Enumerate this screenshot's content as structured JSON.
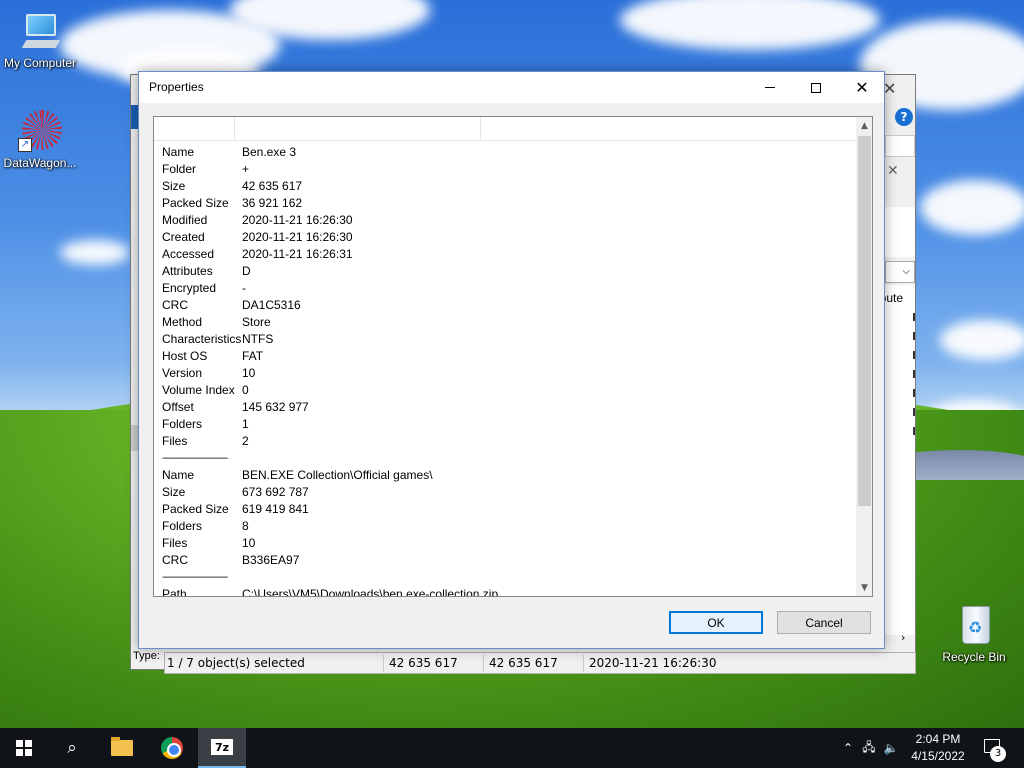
{
  "desktop": {
    "icons": [
      {
        "label": "My Computer"
      },
      {
        "label": "DataWagon..."
      },
      {
        "label": "Recycle Bin"
      }
    ]
  },
  "background_window": {
    "type_label": "Type: ",
    "column_fragment": "ribute",
    "status": {
      "selected": "1 / 7 object(s) selected",
      "size": "42 635 617",
      "packed": "42 635 617",
      "modified": "2020-11-21 16:26:30"
    }
  },
  "dialog": {
    "title": "Properties",
    "properties": [
      {
        "k": "Name",
        "v": "Ben.exe 3"
      },
      {
        "k": "Folder",
        "v": "+"
      },
      {
        "k": "Size",
        "v": "42 635 617"
      },
      {
        "k": "Packed Size",
        "v": "36 921 162"
      },
      {
        "k": "Modified",
        "v": "2020-11-21 16:26:30"
      },
      {
        "k": "Created",
        "v": "2020-11-21 16:26:30"
      },
      {
        "k": "Accessed",
        "v": "2020-11-21 16:26:31"
      },
      {
        "k": "Attributes",
        "v": "D"
      },
      {
        "k": "Encrypted",
        "v": "-"
      },
      {
        "k": "CRC",
        "v": "DA1C5316"
      },
      {
        "k": "Method",
        "v": "Store"
      },
      {
        "k": "Characteristics",
        "v": "NTFS"
      },
      {
        "k": "Host OS",
        "v": "FAT"
      },
      {
        "k": "Version",
        "v": "10"
      },
      {
        "k": "Volume Index",
        "v": "0"
      },
      {
        "k": "Offset",
        "v": "145 632 977"
      },
      {
        "k": "Folders",
        "v": "1"
      },
      {
        "k": "Files",
        "v": "2"
      },
      {
        "k": "----------------------------",
        "v": ""
      },
      {
        "k": "Name",
        "v": "BEN.EXE Collection\\Official games\\"
      },
      {
        "k": "Size",
        "v": "673 692 787"
      },
      {
        "k": "Packed Size",
        "v": "619 419 841"
      },
      {
        "k": "Folders",
        "v": "8"
      },
      {
        "k": "Files",
        "v": "10"
      },
      {
        "k": "CRC",
        "v": "B336EA97"
      },
      {
        "k": "----------------------------",
        "v": ""
      },
      {
        "k": "Path",
        "v": "C:\\Users\\VM5\\Downloads\\ben.exe-collection.zip"
      }
    ],
    "ok_label": "OK",
    "cancel_label": "Cancel"
  },
  "taskbar": {
    "time": "2:04 PM",
    "date": "4/15/2022",
    "notification_count": "3",
    "seven_zip_label": "7z"
  },
  "colors": {
    "accent": "#0078d7",
    "taskbar": "#101418"
  }
}
